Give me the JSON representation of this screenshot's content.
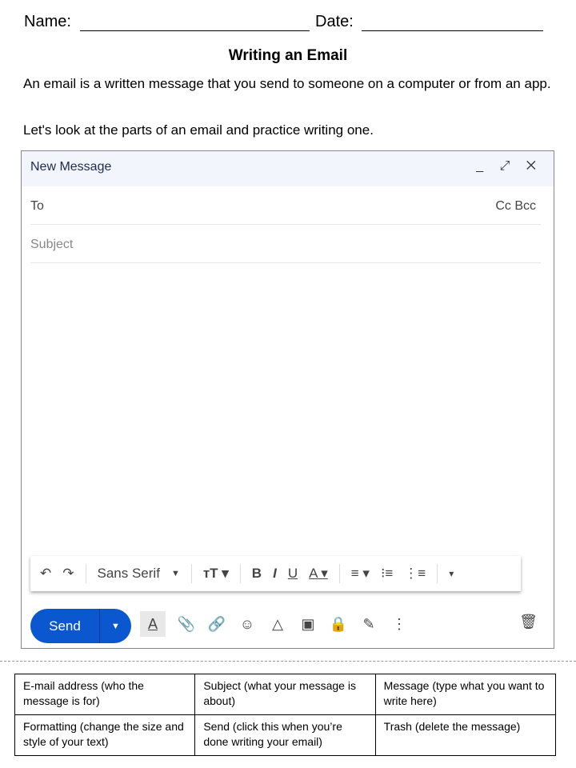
{
  "header": {
    "name_label": "Name:",
    "date_label": "Date:"
  },
  "title": "Writing an Email",
  "intro": [
    "An email is a written message that you send to someone on a computer or from an app.",
    "Let's look at the parts of an email and practice writing one."
  ],
  "compose": {
    "title": "New Message",
    "controls": "_ ⤢ ✕",
    "to": "To",
    "cc_bcc": "Cc Bcc",
    "subject": "Subject",
    "toolbar": {
      "undo": "↶",
      "redo": "↷",
      "font": "Sans Serif",
      "size": "тT ▾",
      "bold": "B",
      "italic": "I",
      "underline": "U",
      "color": "A ▾",
      "align": "≡ ▾",
      "numbered": "⁝≡",
      "bulleted": "⋮≡",
      "more": "▾"
    },
    "send": "Send",
    "send_options": "▼",
    "icons": {
      "format": "A",
      "attach": "📎",
      "link": "🔗",
      "emoji": "☺",
      "drive": "△",
      "photo": "▣",
      "confidential": "🔒",
      "signature": "✎",
      "more": "⋮",
      "trash": "🗑"
    }
  },
  "table": [
    [
      "E-mail address (who the message is for)",
      "Subject (what your message is about)",
      "Message (type what you want to write here)"
    ],
    [
      "Formatting (change the size and style of your text)",
      "Send (click this when you’re done writing your email)",
      "Trash (delete the message)"
    ]
  ]
}
